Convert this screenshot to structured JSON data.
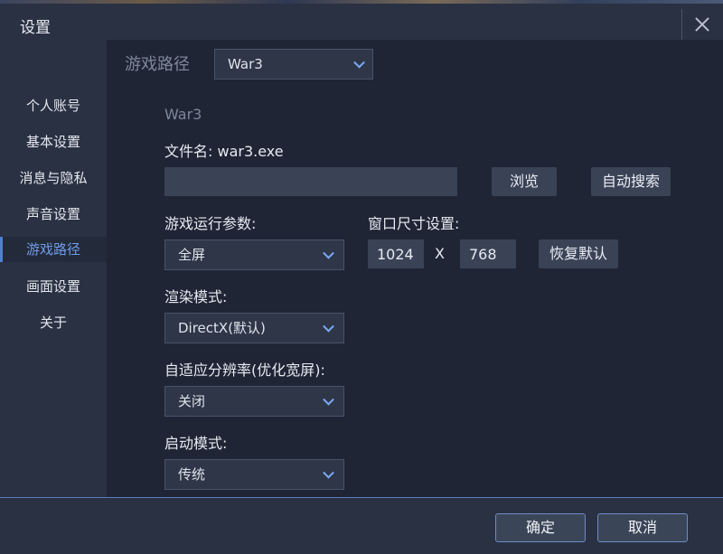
{
  "window": {
    "title": "设置"
  },
  "sidebar": {
    "items": [
      {
        "label": "个人账号"
      },
      {
        "label": "基本设置"
      },
      {
        "label": "消息与隐私"
      },
      {
        "label": "声音设置"
      },
      {
        "label": "游戏路径",
        "active": true
      },
      {
        "label": "画面设置"
      },
      {
        "label": "关于"
      }
    ]
  },
  "game_path": {
    "section_label": "游戏路径",
    "game_select": "War3",
    "game_name": "War3",
    "filename_label": "文件名: war3.exe",
    "path_value": "",
    "browse_label": "浏览",
    "auto_search_label": "自动搜索"
  },
  "run_params": {
    "label": "游戏运行参数:",
    "value": "全屏"
  },
  "window_size": {
    "label": "窗口尺寸设置:",
    "width": "1024",
    "sep": "X",
    "height": "768",
    "reset_label": "恢复默认"
  },
  "render_mode": {
    "label": "渲染模式:",
    "value": "DirectX(默认)"
  },
  "adaptive_res": {
    "label": "自适应分辨率(优化宽屏):",
    "value": "关闭"
  },
  "launch_mode": {
    "label": "启动模式:",
    "value": "传统"
  },
  "footer": {
    "ok_label": "确定",
    "cancel_label": "取消"
  },
  "colors": {
    "accent": "#4f7fd3",
    "active_text": "#6f9ce8",
    "background": "#1f2535",
    "panel": "#2a3142"
  }
}
